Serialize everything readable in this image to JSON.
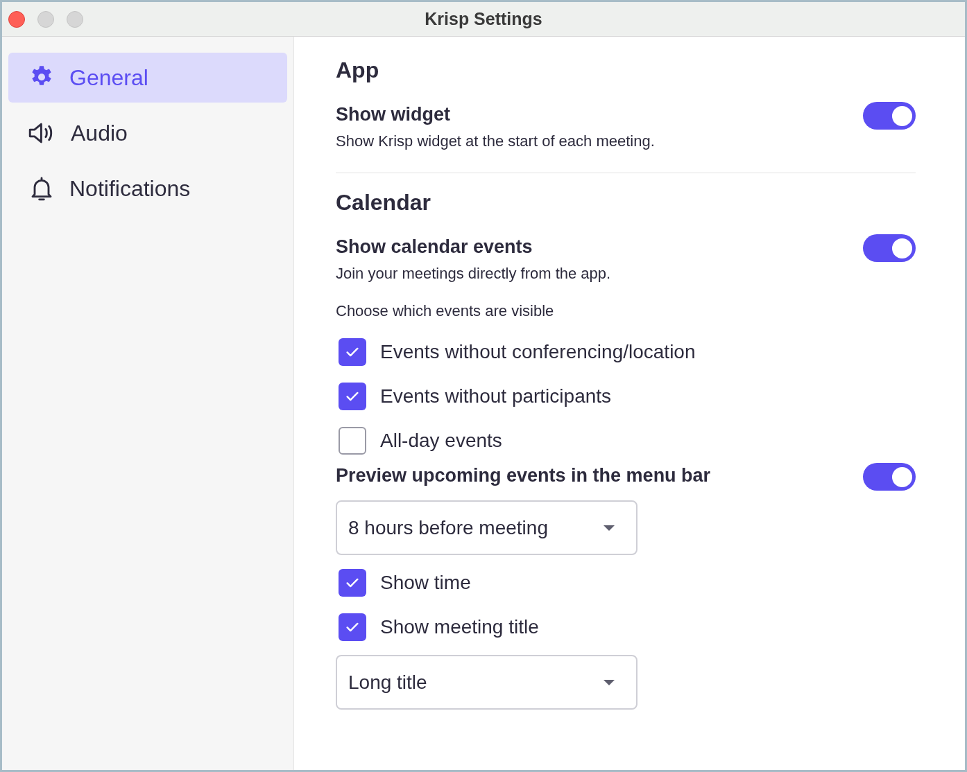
{
  "window": {
    "title": "Krisp Settings"
  },
  "sidebar": {
    "items": [
      {
        "label": "General",
        "selected": true
      },
      {
        "label": "Audio",
        "selected": false
      },
      {
        "label": "Notifications",
        "selected": false
      }
    ]
  },
  "sections": [
    {
      "title": "App",
      "items": [
        {
          "kind": "toggle",
          "label": "Show widget",
          "description": "Show Krisp widget at the start of each meeting.",
          "on": true
        }
      ]
    },
    {
      "title": "Calendar",
      "items": [
        {
          "kind": "toggle",
          "label": "Show calendar events",
          "description": "Join your meetings directly from the app.",
          "on": true
        },
        {
          "kind": "caption",
          "text": "Choose which events are visible"
        },
        {
          "kind": "checkbox",
          "label": "Events without conferencing/location",
          "checked": true
        },
        {
          "kind": "checkbox",
          "label": "Events without participants",
          "checked": true
        },
        {
          "kind": "checkbox",
          "label": "All-day events",
          "checked": false
        },
        {
          "kind": "toggle",
          "label": "Preview upcoming events in the menu bar",
          "on": true
        },
        {
          "kind": "dropdown",
          "value": "8 hours before meeting"
        },
        {
          "kind": "checkbox",
          "label": "Show time",
          "checked": true
        },
        {
          "kind": "checkbox",
          "label": "Show meeting title",
          "checked": true
        },
        {
          "kind": "dropdown",
          "value": "Long title"
        }
      ]
    }
  ]
}
